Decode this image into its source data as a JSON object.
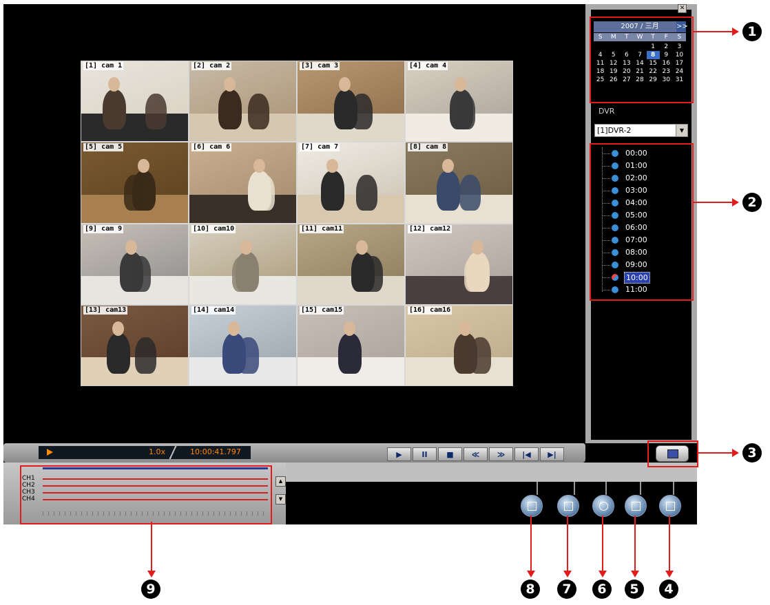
{
  "calendar": {
    "prev": "<<",
    "next": ">>",
    "month_label": "2007 / 三月",
    "weekdays": [
      "S",
      "M",
      "T",
      "W",
      "T",
      "F",
      "S"
    ],
    "days": [
      "",
      "",
      "",
      "",
      "1",
      "2",
      "3",
      "4",
      "5",
      "6",
      "7",
      "8",
      "9",
      "10",
      "11",
      "12",
      "13",
      "14",
      "15",
      "16",
      "17",
      "18",
      "19",
      "20",
      "21",
      "22",
      "23",
      "24",
      "25",
      "26",
      "27",
      "28",
      "29",
      "30",
      "31"
    ],
    "selected_day": "8"
  },
  "dvr": {
    "label": "DVR",
    "selected": "[1]DVR-2"
  },
  "hours": [
    "00:00",
    "01:00",
    "02:00",
    "03:00",
    "04:00",
    "05:00",
    "06:00",
    "07:00",
    "08:00",
    "09:00",
    "10:00",
    "11:00"
  ],
  "selected_hour": "10:00",
  "cameras": [
    "[1] cam 1",
    "[2] cam 2",
    "[3] cam 3",
    "[4] cam 4",
    "[5] cam 5",
    "[6] cam 6",
    "[7] cam 7",
    "[8] cam 8",
    "[9] cam 9",
    "[10] cam10",
    "[11] cam11",
    "[12] cam12",
    "[13] cam13",
    "[14] cam14",
    "[15] cam15",
    "[16] cam16"
  ],
  "status": {
    "speed": "1.0x",
    "time": "10:00:41.797"
  },
  "playback_buttons": [
    "▶",
    "II",
    "■",
    "≪",
    "≫",
    "|◀",
    "▶|"
  ],
  "channels": [
    "CH1",
    "CH2",
    "CH3",
    "CH4"
  ],
  "callouts": [
    "1",
    "2",
    "3",
    "4",
    "5",
    "6",
    "7",
    "8",
    "9"
  ]
}
